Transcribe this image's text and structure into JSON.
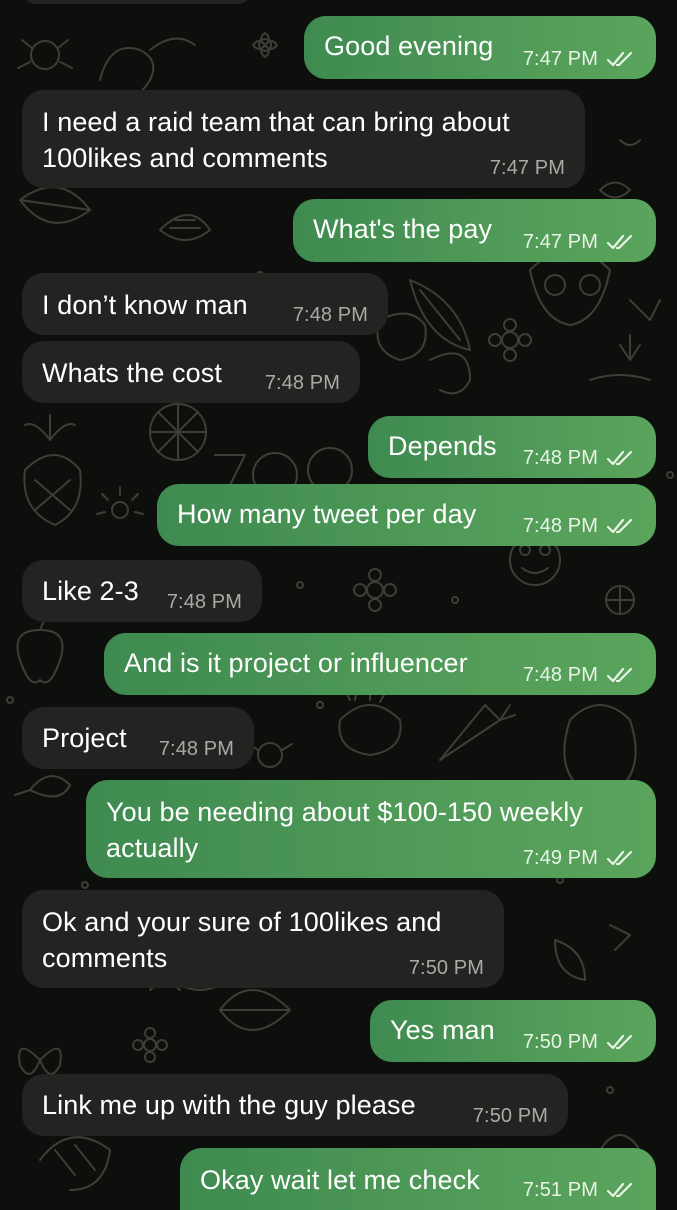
{
  "conversation": {
    "messages": [
      {
        "text": "Good evening",
        "time": "7:47 PM"
      },
      {
        "text": "I need a raid team that can bring about\n100likes and comments",
        "time": "7:47 PM"
      },
      {
        "text": "What's the pay",
        "time": "7:47 PM"
      },
      {
        "text": "I don’t know man",
        "time": "7:48 PM"
      },
      {
        "text": "Whats the cost",
        "time": "7:48 PM"
      },
      {
        "text": "Depends",
        "time": "7:48 PM"
      },
      {
        "text": "How many tweet per day",
        "time": "7:48 PM"
      },
      {
        "text": "Like 2-3",
        "time": "7:48 PM"
      },
      {
        "text": "And is it project or influencer",
        "time": "7:48 PM"
      },
      {
        "text": "Project",
        "time": "7:48 PM"
      },
      {
        "text": "You be needing about $100-150 weekly\nactually",
        "time": "7:49 PM"
      },
      {
        "text": "Ok and your sure of 100likes and\ncomments",
        "time": "7:50 PM"
      },
      {
        "text": "Yes man",
        "time": "7:50 PM"
      },
      {
        "text": "Link me up with the guy please",
        "time": "7:50 PM"
      },
      {
        "text": "Okay wait let me check",
        "time": "7:51 PM"
      }
    ]
  },
  "icons": {
    "read_receipt": "double-check-icon",
    "wallpaper": "doodle-pattern"
  },
  "colors": {
    "background": "#0d0f0c",
    "incoming_bubble": "#222422",
    "outgoing_bubble_start": "#3e8a50",
    "outgoing_bubble_end": "#5aa45c",
    "message_text": "#ffffff",
    "incoming_time": "#a8aaa6",
    "outgoing_time": "#e8f4e6"
  }
}
